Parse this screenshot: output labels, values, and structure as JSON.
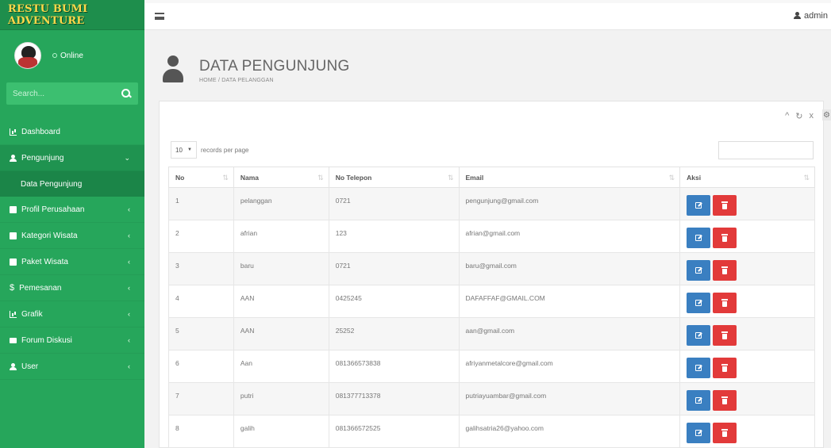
{
  "brand": {
    "name": "RESTU BUMI ADVENTURE"
  },
  "user_panel": {
    "status": "Online"
  },
  "sidebar_search": {
    "placeholder": "Search..."
  },
  "menu": {
    "dashboard": "Dashboard",
    "pengunjung": "Pengunjung",
    "data_pengunjung": "Data Pengunjung",
    "profil": "Profil Perusahaan",
    "kategori": "Kategori Wisata",
    "paket": "Paket Wisata",
    "pemesanan": "Pemesanan",
    "grafik": "Grafik",
    "forum": "Forum Diskusi",
    "user": "User"
  },
  "topbar": {
    "user": "admin"
  },
  "page": {
    "title": "DATA PENGUNJUNG",
    "breadcrumb": "HOME / DATA PELANGGAN"
  },
  "table_controls": {
    "page_size": "10",
    "records_label": "records per page",
    "panel_tools": {
      "collapse": "^",
      "refresh": "↻",
      "close": "x",
      "settings": "⚙"
    }
  },
  "table": {
    "headers": {
      "no": "No",
      "nama": "Nama",
      "telepon": "No Telepon",
      "email": "Email",
      "aksi": "Aksi"
    },
    "rows": [
      {
        "no": "1",
        "nama": "pelanggan",
        "telepon": "0721",
        "email": "pengunjung@gmail.com"
      },
      {
        "no": "2",
        "nama": "afrian",
        "telepon": "123",
        "email": "afrian@gmail.com"
      },
      {
        "no": "3",
        "nama": "baru",
        "telepon": "0721",
        "email": "baru@gmail.com"
      },
      {
        "no": "4",
        "nama": "AAN",
        "telepon": "0425245",
        "email": "DAFAFFAF@GMAIL.COM"
      },
      {
        "no": "5",
        "nama": "AAN",
        "telepon": "25252",
        "email": "aan@gmail.com"
      },
      {
        "no": "6",
        "nama": "Aan",
        "telepon": "081366573838",
        "email": "afriyanmetalcore@gmail.com"
      },
      {
        "no": "7",
        "nama": "putri",
        "telepon": "081377713378",
        "email": "putriayuambar@gmail.com"
      },
      {
        "no": "8",
        "nama": "galih",
        "telepon": "081366572525",
        "email": "galihsatria26@yahoo.com"
      }
    ]
  },
  "colors": {
    "sidebar": "#26a65b",
    "edit": "#3a7fc1",
    "delete": "#e23a3a",
    "brand_text": "#ffd84a"
  }
}
